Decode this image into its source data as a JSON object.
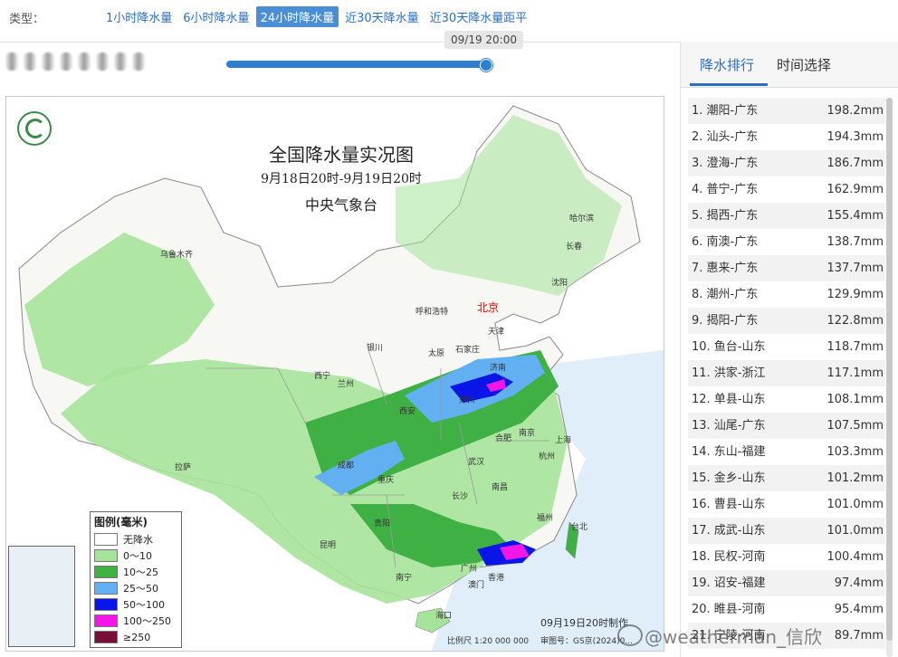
{
  "toolbar": {
    "type_label": "类型：",
    "tabs": [
      {
        "label": "1小时降水量",
        "active": false
      },
      {
        "label": "6小时降水量",
        "active": false
      },
      {
        "label": "24小时降水量",
        "active": true
      },
      {
        "label": "近30天降水量",
        "active": false
      },
      {
        "label": "近30天降水量距平",
        "active": false
      }
    ]
  },
  "timeline": {
    "current_time": "09/19 20:00",
    "progress": 1.0
  },
  "map": {
    "title": "全国降水量实况图",
    "subtitle": "9月18日20时-9月19日20时",
    "org": "中央气象台",
    "cities": {
      "beijing": "北京",
      "harbin": "哈尔滨",
      "changchun": "长春",
      "urumqi": "乌鲁木齐",
      "shenyang": "沈阳",
      "hohhot": "呼和浩特",
      "tianjin": "天津",
      "yinchuan": "银川",
      "taiyuan": "太原",
      "shijiazhuang": "石家庄",
      "jinan": "济南",
      "xining": "西宁",
      "lanzhou": "兰州",
      "zhengzhou": "郑州",
      "xian": "西安",
      "nanjing": "南京",
      "hefei": "合肥",
      "shanghai": "上海",
      "lhasa": "拉萨",
      "chengdu": "成都",
      "wuhan": "武汉",
      "hangzhou": "杭州",
      "chongqing": "重庆",
      "changsha": "长沙",
      "nanchang": "南昌",
      "fuzhou": "福州",
      "guiyang": "贵阳",
      "taibei": "台北",
      "kunming": "昆明",
      "guangzhou": "广州",
      "nanning": "南宁",
      "hongkong": "香港",
      "macau": "澳门",
      "haikou": "海口"
    },
    "legend_title": "图例(毫米)",
    "legend": [
      {
        "label": "无降水",
        "color": "#ffffff"
      },
      {
        "label": "0～10",
        "color": "#a6e39a"
      },
      {
        "label": "10～25",
        "color": "#3fb044"
      },
      {
        "label": "25～50",
        "color": "#62b0f2"
      },
      {
        "label": "50～100",
        "color": "#0a15e8"
      },
      {
        "label": "100～250",
        "color": "#f316e6"
      },
      {
        "label": "≥250",
        "color": "#7a0f3a"
      }
    ],
    "made_time": "09月19日20时制作",
    "scale": "比例尺 1:20 000 000",
    "review_no": "审图号：GS京(2024)0..."
  },
  "sidebar": {
    "tabs": [
      {
        "label": "降水排行",
        "active": true
      },
      {
        "label": "时间选择",
        "active": false
      }
    ],
    "ranking": [
      {
        "name": "1. 潮阳-广东",
        "value": "198.2mm"
      },
      {
        "name": "2. 汕头-广东",
        "value": "194.3mm"
      },
      {
        "name": "3. 澄海-广东",
        "value": "186.7mm"
      },
      {
        "name": "4. 普宁-广东",
        "value": "162.9mm"
      },
      {
        "name": "5. 揭西-广东",
        "value": "155.4mm"
      },
      {
        "name": "6. 南澳-广东",
        "value": "138.7mm"
      },
      {
        "name": "7. 惠来-广东",
        "value": "137.7mm"
      },
      {
        "name": "8. 潮州-广东",
        "value": "129.9mm"
      },
      {
        "name": "9. 揭阳-广东",
        "value": "122.8mm"
      },
      {
        "name": "10. 鱼台-山东",
        "value": "118.7mm"
      },
      {
        "name": "11. 洪家-浙江",
        "value": "117.1mm"
      },
      {
        "name": "12. 单县-山东",
        "value": "108.1mm"
      },
      {
        "name": "13. 汕尾-广东",
        "value": "107.5mm"
      },
      {
        "name": "14. 东山-福建",
        "value": "103.3mm"
      },
      {
        "name": "15. 金乡-山东",
        "value": "101.2mm"
      },
      {
        "name": "16. 曹县-山东",
        "value": "101.0mm"
      },
      {
        "name": "17. 成武-山东",
        "value": "101.0mm"
      },
      {
        "name": "18. 民权-河南",
        "value": "100.4mm"
      },
      {
        "name": "19. 诏安-福建",
        "value": "97.4mm"
      },
      {
        "name": "20. 睢县-河南",
        "value": "95.4mm"
      },
      {
        "name": "21. 宁陵-河南",
        "value": "89.7mm"
      }
    ]
  },
  "watermark": "@weatherman_信欣"
}
